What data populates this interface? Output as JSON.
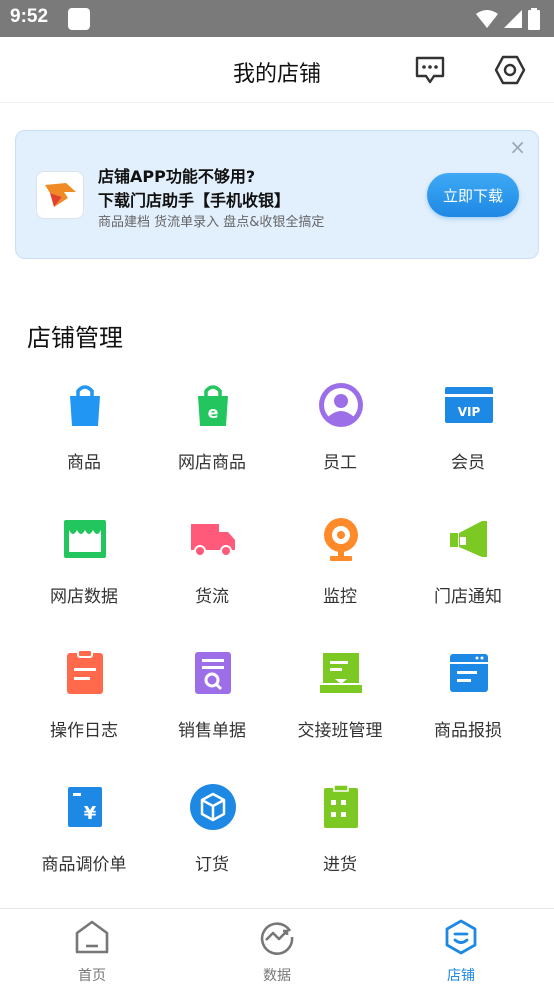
{
  "status": {
    "time": "9:52"
  },
  "header": {
    "title": "我的店铺",
    "message_icon": "message-icon",
    "settings_icon": "settings-icon"
  },
  "banner": {
    "line1": "店铺APP功能不够用?",
    "line2": "下载门店助手【手机收银】",
    "line3": "商品建档 货流单录入 盘点&收银全搞定",
    "button": "立即下载",
    "close": "×"
  },
  "section": {
    "title": "店铺管理"
  },
  "items": [
    {
      "label": "商品",
      "icon": "shopping-bag-icon",
      "color": "#2196f3"
    },
    {
      "label": "网店商品",
      "icon": "online-shop-bag-icon",
      "color": "#22c55e"
    },
    {
      "label": "员工",
      "icon": "staff-icon",
      "color": "#9c6ee8"
    },
    {
      "label": "会员",
      "icon": "vip-card-icon",
      "color": "#1e88e5"
    },
    {
      "label": "网店数据",
      "icon": "storefront-icon",
      "color": "#22c55e"
    },
    {
      "label": "货流",
      "icon": "truck-icon",
      "color": "#ff5a79"
    },
    {
      "label": "监控",
      "icon": "camera-icon",
      "color": "#ff8a2a"
    },
    {
      "label": "门店通知",
      "icon": "megaphone-icon",
      "color": "#7cc924"
    },
    {
      "label": "操作日志",
      "icon": "clipboard-icon",
      "color": "#ff6a4d"
    },
    {
      "label": "销售单据",
      "icon": "receipt-search-icon",
      "color": "#9c6ee8"
    },
    {
      "label": "交接班管理",
      "icon": "handover-monitor-icon",
      "color": "#7cc924"
    },
    {
      "label": "商品报损",
      "icon": "calendar-doc-icon",
      "color": "#1e88e5"
    },
    {
      "label": "商品调价单",
      "icon": "price-doc-icon",
      "color": "#1e88e5"
    },
    {
      "label": "订货",
      "icon": "cube-icon",
      "color": "#1e88e5"
    },
    {
      "label": "进货",
      "icon": "inventory-clipboard-icon",
      "color": "#7cc924"
    }
  ],
  "tabs": [
    {
      "label": "首页",
      "icon": "home-icon",
      "active": false
    },
    {
      "label": "数据",
      "icon": "data-chart-icon",
      "active": false
    },
    {
      "label": "店铺",
      "icon": "store-icon",
      "active": true
    }
  ]
}
